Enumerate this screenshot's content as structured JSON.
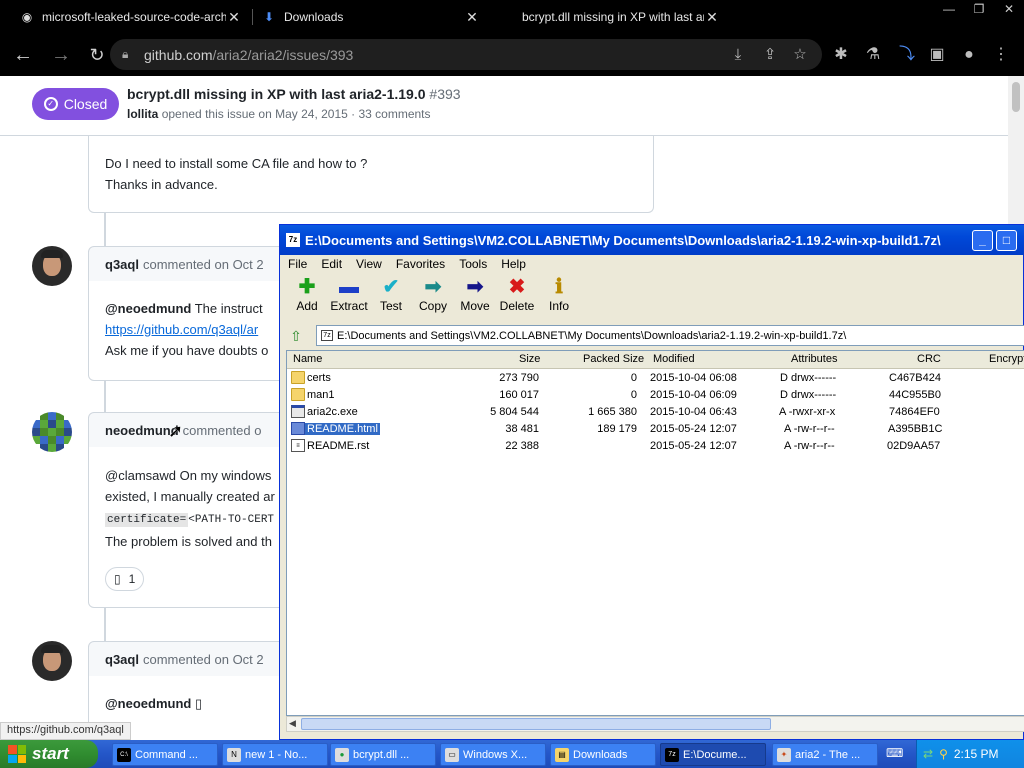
{
  "browser": {
    "tabs": [
      {
        "label": "microsoft-leaked-source-code-archi",
        "icon": "github-icon",
        "close": "✕"
      },
      {
        "label": "Downloads",
        "icon": "download-icon",
        "close": "✕"
      },
      {
        "label": "bcrypt.dll missing in XP with last aria",
        "icon": "github-icon",
        "close": "✕"
      }
    ],
    "url_host": "github.com",
    "url_path": "/aria2/aria2/issues/393",
    "window_controls": [
      "—",
      "❐",
      "✕"
    ]
  },
  "issue": {
    "state": "Closed",
    "title": "bcrypt.dll missing in XP with last aria2-1.19.0",
    "number": "#393",
    "author": "lollita",
    "meta": "opened this issue on May 24, 2015 · 33 comments"
  },
  "comments": [
    {
      "body_lines": [
        "Do I need to install some CA file and how to ?",
        "Thanks in advance."
      ]
    },
    {
      "author": "q3aql",
      "meta": "commented on Oct 2",
      "mention": "@neoedmund",
      "text_after": " The instruct",
      "link": "https://github.com/q3aql/ar",
      "line3": "Ask me if you have doubts o"
    },
    {
      "author": "neoedmund",
      "meta": "commented o",
      "line1": "@clamsawd On my windows",
      "line2": "existed, I manually created ar",
      "code": "certificate=",
      "code_after": "<PATH-TO-CERT",
      "line4": "The problem is solved and th",
      "reaction_count": "1"
    },
    {
      "author": "q3aql",
      "meta": "commented on Oct 2",
      "mention": "@neoedmund",
      "suffix": "▯"
    }
  ],
  "status_url": "https://github.com/q3aql",
  "zip": {
    "title": "E:\\Documents and Settings\\VM2.COLLABNET\\My Documents\\Downloads\\aria2-1.19.2-win-xp-build1.7z\\",
    "menu": [
      "File",
      "Edit",
      "View",
      "Favorites",
      "Tools",
      "Help"
    ],
    "tools": [
      {
        "label": "Add",
        "glyph": "✚",
        "color": "#1aa01a"
      },
      {
        "label": "Extract",
        "glyph": "▬",
        "color": "#1d3fc8"
      },
      {
        "label": "Test",
        "glyph": "✔",
        "color": "#1ab0c8"
      },
      {
        "label": "Copy",
        "glyph": "➡",
        "color": "#1a8a8a"
      },
      {
        "label": "Move",
        "glyph": "➡",
        "color": "#15158a"
      },
      {
        "label": "Delete",
        "glyph": "✖",
        "color": "#d81a1a"
      },
      {
        "label": "Info",
        "glyph": "ℹ",
        "color": "#b88a00"
      }
    ],
    "address": "E:\\Documents and Settings\\VM2.COLLABNET\\My Documents\\Downloads\\aria2-1.19.2-win-xp-build1.7z\\",
    "columns": [
      "Name",
      "Size",
      "Packed Size",
      "Modified",
      "Attributes",
      "CRC",
      "Encrypt"
    ],
    "rows": [
      {
        "name": "certs",
        "size": "273 790",
        "packed": "0",
        "modified": "2015-10-04 06:08",
        "attr": "D drwx------",
        "crc": "C467B424",
        "type": "folder"
      },
      {
        "name": "man1",
        "size": "160 017",
        "packed": "0",
        "modified": "2015-10-04 06:09",
        "attr": "D drwx------",
        "crc": "44C955B0",
        "type": "folder"
      },
      {
        "name": "aria2c.exe",
        "size": "5 804 544",
        "packed": "1 665 380",
        "modified": "2015-10-04 06:43",
        "attr": "A -rwxr-xr-x",
        "crc": "74864EF0",
        "type": "exe"
      },
      {
        "name": "README.html",
        "size": "38 481",
        "packed": "189 179",
        "modified": "2015-05-24 12:07",
        "attr": "A -rw-r--r--",
        "crc": "A395BB1C",
        "type": "html",
        "selected": true
      },
      {
        "name": "README.rst",
        "size": "22 388",
        "packed": "",
        "modified": "2015-05-24 12:07",
        "attr": "A -rw-r--r--",
        "crc": "02D9AA57",
        "type": "file"
      }
    ]
  },
  "taskbar": {
    "start": "start",
    "buttons": [
      {
        "label": "Command ...",
        "icon": "C:\\"
      },
      {
        "label": "new 1 - No...",
        "icon": "N"
      },
      {
        "label": "bcrypt.dll ...",
        "icon": "●"
      },
      {
        "label": "Windows X...",
        "icon": "▭"
      },
      {
        "label": "Downloads",
        "icon": "▤"
      },
      {
        "label": "E:\\Docume...",
        "icon": "7z",
        "active": true
      },
      {
        "label": "aria2 - The ...",
        "icon": "✦"
      }
    ],
    "clock": "2:15 PM"
  }
}
